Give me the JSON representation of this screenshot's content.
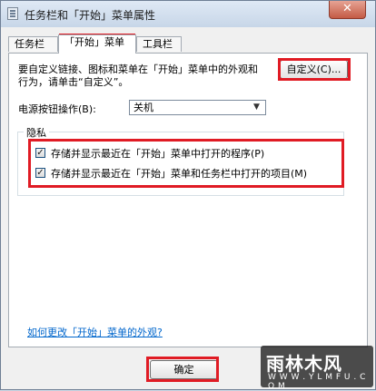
{
  "window": {
    "title": "任务栏和「开始」菜单属性",
    "close_label": "✕"
  },
  "tabs": [
    {
      "label": "任务栏"
    },
    {
      "label": "「开始」菜单"
    },
    {
      "label": "工具栏"
    }
  ],
  "customize": {
    "description": "要自定义链接、图标和菜单在「开始」菜单中的外观和行为，请单击“自定义”。",
    "button_label": "自定义(C)..."
  },
  "power": {
    "label": "电源按钮操作(B):",
    "selected": "关机"
  },
  "privacy": {
    "title": "隐私",
    "options": [
      {
        "label": "存储并显示最近在「开始」菜单中打开的程序(P)",
        "checked": true
      },
      {
        "label": "存储并显示最近在「开始」菜单和任务栏中打开的项目(M)",
        "checked": true
      }
    ]
  },
  "link": "如何更改「开始」菜单的外观?",
  "ok_label": "确定",
  "watermark": {
    "text": "雨林木风",
    "url": "W W W . Y L M F U . C O M"
  },
  "colors": {
    "highlight": "#e01b24",
    "link": "#0066cc"
  }
}
